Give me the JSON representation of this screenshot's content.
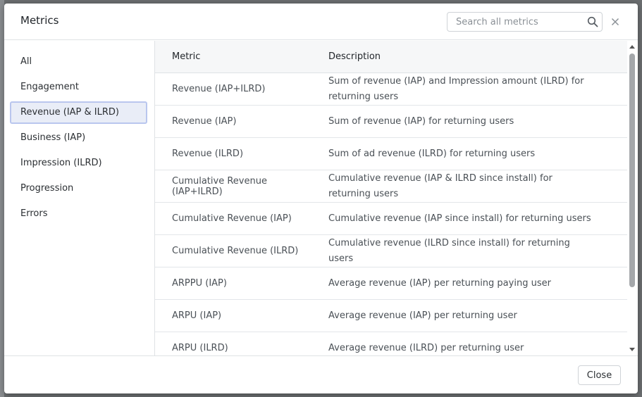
{
  "modal": {
    "title": "Metrics",
    "close_label": "Close"
  },
  "search": {
    "placeholder": "Search all metrics",
    "value": ""
  },
  "icons": {
    "search": "search-icon",
    "close": "close-icon"
  },
  "colors": {
    "active_bg": "#e9edf7",
    "active_border": "#b9c6ee"
  },
  "sidebar": {
    "items": [
      {
        "label": "All"
      },
      {
        "label": "Engagement"
      },
      {
        "label": "Revenue (IAP & ILRD)",
        "active": true
      },
      {
        "label": "Business (IAP)"
      },
      {
        "label": "Impression (ILRD)"
      },
      {
        "label": "Progression"
      },
      {
        "label": "Errors"
      }
    ]
  },
  "table": {
    "headers": {
      "metric": "Metric",
      "description": "Description"
    },
    "rows": [
      {
        "metric": "Revenue (IAP+ILRD)",
        "description": "Sum of revenue (IAP) and Impression amount (ILRD) for returning users"
      },
      {
        "metric": "Revenue (IAP)",
        "description": "Sum of revenue (IAP) for returning users"
      },
      {
        "metric": "Revenue (ILRD)",
        "description": "Sum of ad revenue (ILRD) for returning users"
      },
      {
        "metric": "Cumulative Revenue (IAP+ILRD)",
        "description": "Cumulative revenue (IAP & ILRD since install) for returning users"
      },
      {
        "metric": "Cumulative Revenue (IAP)",
        "description": "Cumulative revenue (IAP since install) for returning users"
      },
      {
        "metric": "Cumulative Revenue (ILRD)",
        "description": "Cumulative revenue (ILRD since install) for returning users"
      },
      {
        "metric": "ARPPU (IAP)",
        "description": "Average revenue (IAP) per returning paying user"
      },
      {
        "metric": "ARPU (IAP)",
        "description": "Average revenue (IAP) per returning user"
      },
      {
        "metric": "ARPU (ILRD)",
        "description": "Average revenue (ILRD) per returning user"
      }
    ]
  }
}
